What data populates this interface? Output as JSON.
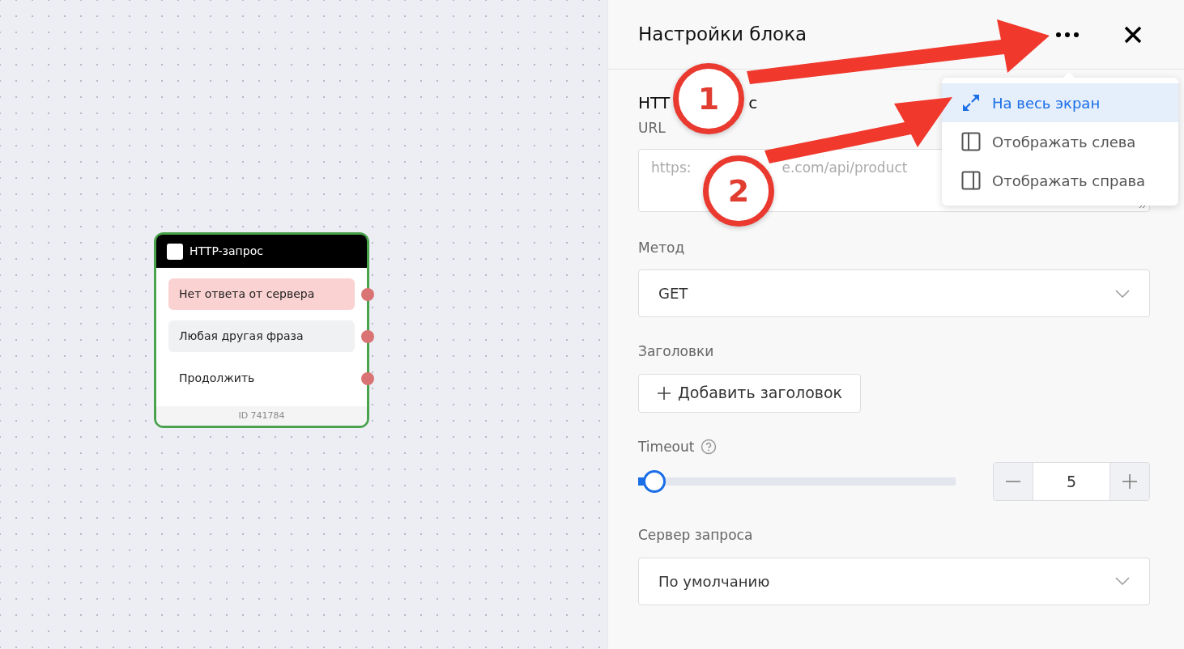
{
  "node": {
    "title": "HTTP-запрос",
    "id_label": "ID 741784",
    "outputs": [
      {
        "label": "Нет ответа от сервера",
        "kind": "error"
      },
      {
        "label": "Любая другая фраза",
        "kind": "fallback"
      },
      {
        "label": "Продолжить",
        "kind": "plain"
      }
    ]
  },
  "panel": {
    "title": "Настройки блока",
    "menu": [
      {
        "label": "На весь экран",
        "kind": "fullscreen",
        "selected": true
      },
      {
        "label": "Отображать слева",
        "kind": "left",
        "selected": false
      },
      {
        "label": "Отображать справа",
        "kind": "right",
        "selected": false
      }
    ],
    "section_title_parts": [
      "HTT",
      "с"
    ],
    "url": {
      "label": "URL",
      "placeholder_parts": [
        "https:",
        "e.com/api/product"
      ]
    },
    "method": {
      "label": "Метод",
      "value": "GET"
    },
    "headers": {
      "label": "Заголовки",
      "button": "Добавить заголовок"
    },
    "timeout": {
      "label": "Timeout",
      "level": 0.05,
      "value": "5"
    },
    "server": {
      "label": "Сервер запроса",
      "value": "По умолчанию"
    }
  },
  "callouts": [
    "1",
    "2"
  ]
}
